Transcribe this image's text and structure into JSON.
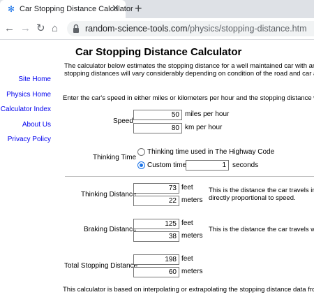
{
  "browser": {
    "tab_title": "Car Stopping Distance Calculator",
    "url_host": "random-science-tools.com",
    "url_path": "/physics/stopping-distance.htm"
  },
  "page": {
    "title": "Car Stopping Distance Calculator",
    "intro_line1": "The calculator below estimates the stopping distance for a well maintained car with an al",
    "intro_line2": "stopping distances will vary considerably depending on condition of the road and car as w",
    "instructions": "Enter the car's speed in either miles or kilometers per hour and the stopping distance will",
    "footer": "This calculator is based on interpolating or extrapolating the stopping distance data from"
  },
  "sidebar": {
    "items": [
      "Site Home",
      "Physics Home",
      "Calculator Index",
      "About Us",
      "Privacy Policy"
    ]
  },
  "speed": {
    "label": "Speed",
    "mph_value": "50",
    "mph_unit": "miles per hour",
    "kmh_value": "80",
    "kmh_unit": "km per hour"
  },
  "thinking_time": {
    "label": "Thinking Time",
    "option1": "Thinking time used in The Highway Code",
    "option2": "Custom time",
    "custom_value": "1",
    "custom_unit": "seconds"
  },
  "thinking_distance": {
    "label": "Thinking Distance",
    "feet": "73",
    "meters": "22",
    "desc1": "This is the distance the car travels in",
    "desc2": "directly proportional to speed."
  },
  "braking_distance": {
    "label": "Braking Distance",
    "feet": "125",
    "meters": "38",
    "desc1": "This is the distance the car travels wh"
  },
  "total_distance": {
    "label": "Total Stopping Distance",
    "feet": "198",
    "meters": "60"
  },
  "units": {
    "feet": "feet",
    "meters": "meters"
  }
}
